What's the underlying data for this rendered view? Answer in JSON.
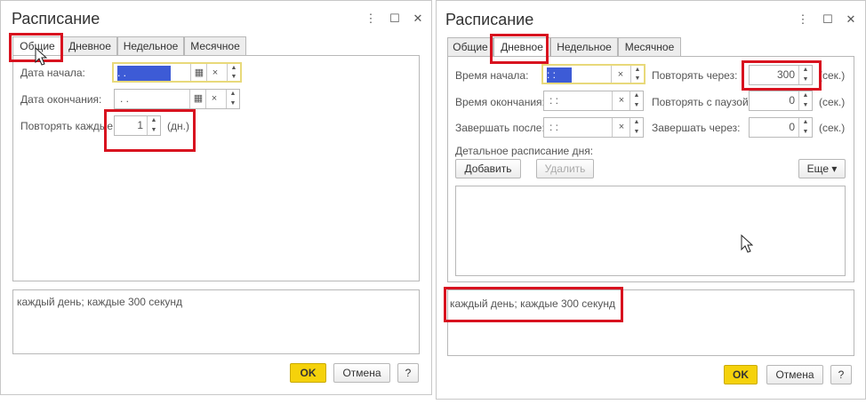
{
  "left": {
    "title": "Расписание",
    "tabs": [
      "Общие",
      "Дневное",
      "Недельное",
      "Месячное"
    ],
    "start_date_label": "Дата начала:",
    "start_date_value": "  .  .",
    "end_date_label": "Дата окончания:",
    "end_date_value": "  .  .",
    "repeat_label": "Повторять каждые:",
    "repeat_value": "1",
    "repeat_unit": "(дн.)",
    "summary": "каждый день; каждые 300 секунд",
    "ok": "OK",
    "cancel": "Отмена",
    "help": "?"
  },
  "right": {
    "title": "Расписание",
    "tabs": [
      "Общие",
      "Дневное",
      "Недельное",
      "Месячное"
    ],
    "start_time_label": "Время начала:",
    "start_time_value": " :  :",
    "end_time_label": "Время окончания:",
    "end_time_value": " :  :",
    "finish_after_label": "Завершать после:",
    "finish_after_value": " :  :",
    "repeat_through_label": "Повторять через:",
    "repeat_through_value": "300",
    "repeat_pause_label": "Повторять с паузой:",
    "repeat_pause_value": "0",
    "finish_through_label": "Завершать через:",
    "finish_through_value": "0",
    "unit": "(сек.)",
    "detail_label": "Детальное расписание дня:",
    "add": "Добавить",
    "delete": "Удалить",
    "more": "Еще",
    "summary": "каждый день; каждые 300 секунд",
    "ok": "OK",
    "cancel": "Отмена",
    "help": "?"
  },
  "icons": {
    "menu": "⋮",
    "maximize": "☐",
    "close": "✕",
    "calendar": "▦",
    "clear": "×",
    "up": "▲",
    "down": "▼",
    "dropdown": "▾"
  },
  "colors": {
    "ok": "#f5d20b",
    "highlight": "#d8121f",
    "focus": "#e8d97a",
    "selection": "#3d5bd6"
  }
}
